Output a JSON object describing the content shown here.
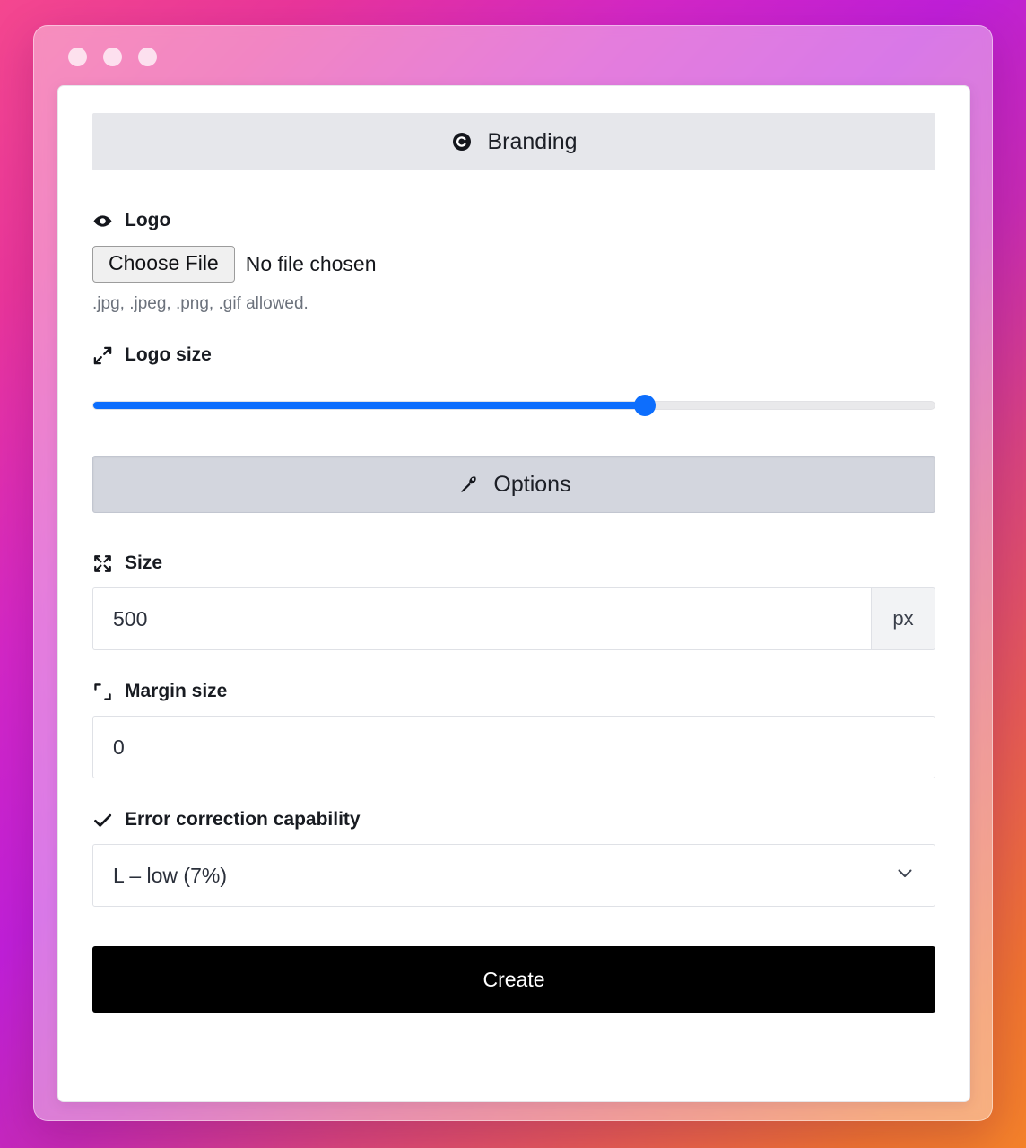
{
  "window": {
    "dots": [
      "close-dot",
      "minimize-dot",
      "maximize-dot"
    ]
  },
  "sections": {
    "branding": {
      "title": "Branding",
      "icon": "branding-copyright-icon"
    },
    "options": {
      "title": "Options",
      "icon": "wrench-icon"
    }
  },
  "logo": {
    "label": "Logo",
    "icon": "eye-icon",
    "choose_file_label": "Choose File",
    "file_status": "No file chosen",
    "hint": ".jpg, .jpeg, .png, .gif allowed."
  },
  "logo_size": {
    "label": "Logo size",
    "icon": "resize-diagonal-icon",
    "percent": 65.6,
    "accent_color": "#0d6efd",
    "track_color": "#e9e9eb"
  },
  "size": {
    "label": "Size",
    "icon": "arrows-out-icon",
    "value": "500",
    "unit": "px"
  },
  "margin_size": {
    "label": "Margin size",
    "icon": "crop-corners-icon",
    "value": "0"
  },
  "error_correction": {
    "label": "Error correction capability",
    "icon": "check-icon",
    "selected": "L – low (7%)",
    "caret": "chevron-down-icon"
  },
  "actions": {
    "create_label": "Create"
  },
  "theme": {
    "gradient_start": "#f4478f",
    "gradient_mid": "#bf1fd8",
    "gradient_end": "#f4812a",
    "button_bg": "#000000",
    "section_branding_bg": "#e6e7eb",
    "section_options_bg": "#d3d6de"
  }
}
